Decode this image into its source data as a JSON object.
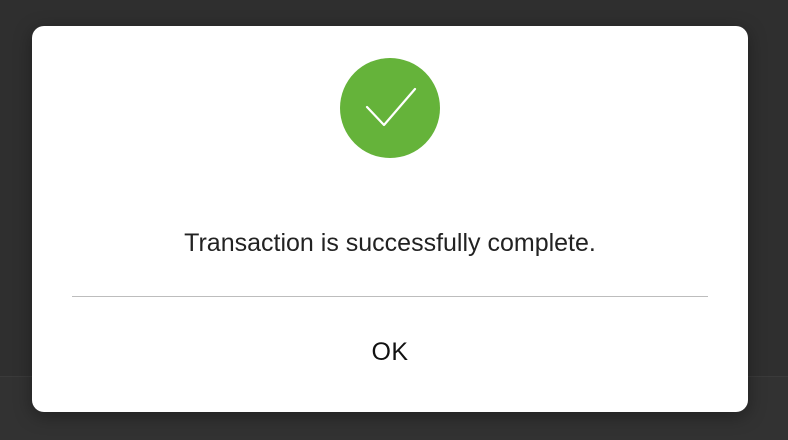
{
  "dialog": {
    "icon": "checkmark-icon",
    "message": "Transaction is successfully complete.",
    "ok_label": "OK"
  },
  "colors": {
    "success": "#65b33a",
    "backdrop": "#2f2f2f",
    "dialog_bg": "#ffffff"
  }
}
